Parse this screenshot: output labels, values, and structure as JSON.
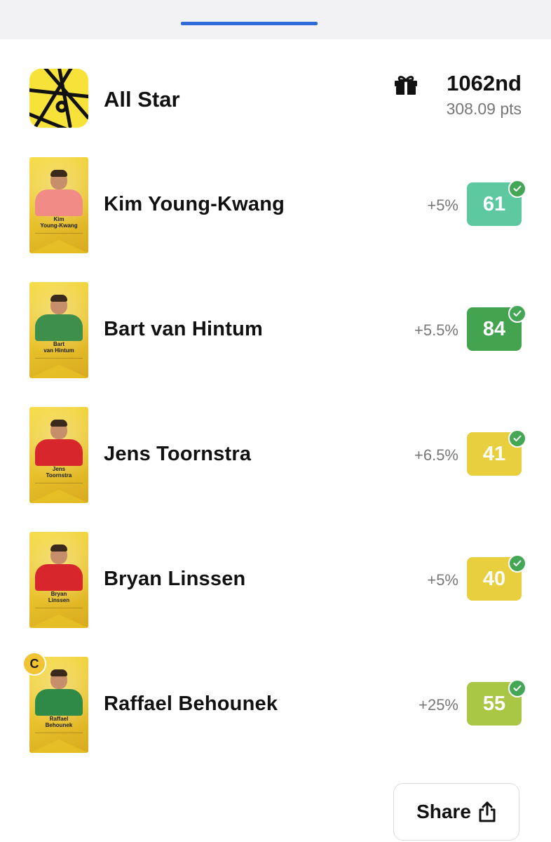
{
  "competition": {
    "title": "All Star",
    "rank": "1062nd",
    "points": "308.09 pts"
  },
  "players": [
    {
      "name": "Kim Young-Kwang",
      "card_name": "Kim\nYoung-Kwang",
      "bonus": "+5%",
      "score": "61",
      "score_color": "#5ec9a1",
      "kit_color": "#f08b86",
      "captain": false
    },
    {
      "name": "Bart van Hintum",
      "card_name": "Bart\nvan Hintum",
      "bonus": "+5.5%",
      "score": "84",
      "score_color": "#43a34e",
      "kit_color": "#3f8f4c",
      "captain": false
    },
    {
      "name": "Jens Toornstra",
      "card_name": "Jens\nToornstra",
      "bonus": "+6.5%",
      "score": "41",
      "score_color": "#e7cf3d",
      "kit_color": "#d8262d",
      "captain": false
    },
    {
      "name": "Bryan Linssen",
      "card_name": "Bryan\nLinssen",
      "bonus": "+5%",
      "score": "40",
      "score_color": "#e7cf3d",
      "kit_color": "#d8262d",
      "captain": false
    },
    {
      "name": "Raffael Behounek",
      "card_name": "Raffael\nBehounek",
      "bonus": "+25%",
      "score": "55",
      "score_color": "#a9c645",
      "kit_color": "#2f8a47",
      "captain": true,
      "captain_label": "C"
    }
  ],
  "share": {
    "label": "Share"
  },
  "icons": {
    "gift": "gift-icon",
    "check": "check-icon",
    "share": "share-icon"
  }
}
